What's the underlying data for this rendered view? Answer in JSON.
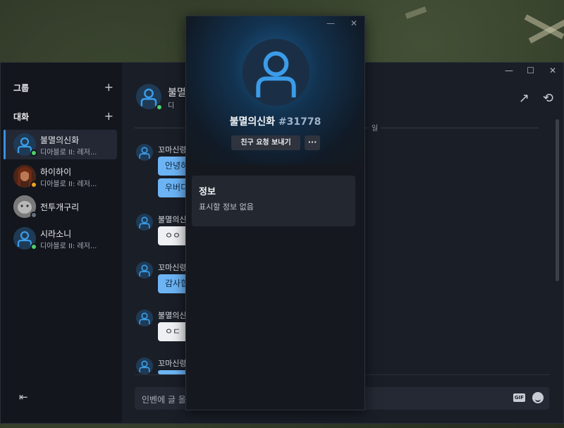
{
  "sidebar": {
    "groups_label": "그룹",
    "conversations_label": "대화",
    "plus": "+",
    "collapse_glyph": "⇤",
    "items": [
      {
        "name": "불멸의신화",
        "sub": "디아블로 II: 레저...",
        "status": "online",
        "active": true
      },
      {
        "name": "하이하이",
        "sub": "디아블로 II: 레저...",
        "status": "away",
        "active": false
      },
      {
        "name": "전투개구리",
        "sub": "",
        "status": "offline",
        "active": false
      },
      {
        "name": "시라소니",
        "sub": "디아블로 II: 레저...",
        "status": "online",
        "active": false
      }
    ]
  },
  "chat": {
    "header_name": "불멸",
    "header_sub": "디",
    "date_partial": "일",
    "messages": [
      {
        "name": "꼬마신령",
        "bubbles": [
          {
            "text": "안녕하",
            "style": "blue"
          },
          {
            "text": "우버디",
            "style": "blue"
          }
        ]
      },
      {
        "name": "불멸의신",
        "bubbles": [
          {
            "text": "ㅇㅇ",
            "style": "white"
          }
        ]
      },
      {
        "name": "꼬마신령",
        "bubbles": [
          {
            "text": "감사합",
            "style": "blue"
          }
        ]
      },
      {
        "name": "불멸의신",
        "bubbles": [
          {
            "text": "ㅇㄷ",
            "style": "white"
          }
        ]
      },
      {
        "name": "꼬마신령",
        "bubbles": []
      }
    ],
    "composer_placeholder": "인벤에 글 올",
    "gif_label": "GIF"
  },
  "window_controls": {
    "minimize": "—",
    "maximize": "☐",
    "close": "✕"
  },
  "profile": {
    "name": "불멸의신화",
    "tag": "#31778",
    "friend_request_label": "친구 요청 보내기",
    "more_label": "···",
    "info_title": "정보",
    "info_text": "표시할 정보 없음"
  },
  "colors": {
    "accent": "#3b8fe0",
    "online": "#4ed06b",
    "away": "#f0a020",
    "offline": "#6b717c"
  }
}
